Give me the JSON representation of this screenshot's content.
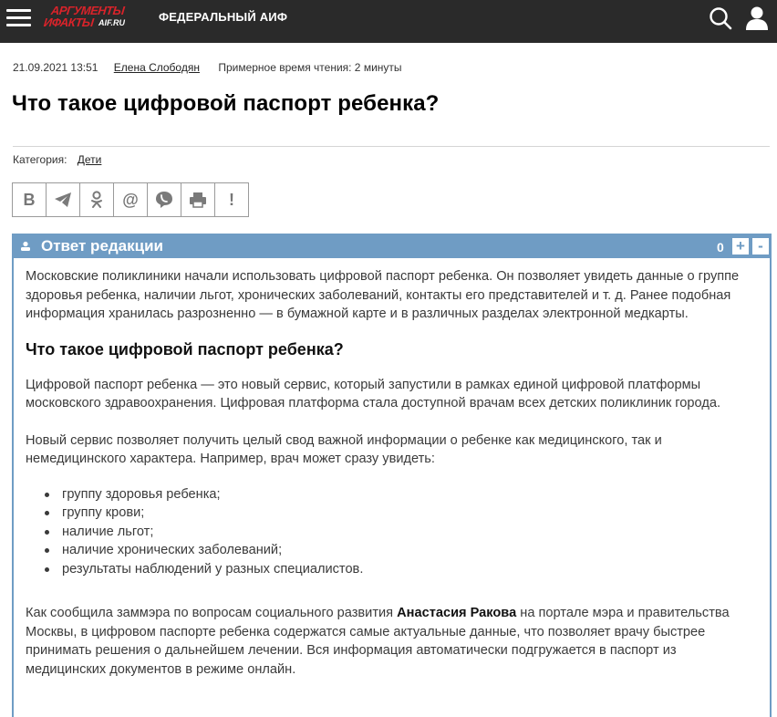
{
  "header": {
    "logo_line1": "АРГУМЕНТЫ",
    "logo_line2": "ИФАКТЫ",
    "logo_site": "AIF.RU",
    "nav_label": "ФЕДЕРАЛЬНЫЙ АИФ",
    "colors": {
      "bar": "#2a2a2a",
      "logo_red": "#d8232a"
    }
  },
  "meta": {
    "date": "21.09.2021 13:51",
    "author": "Елена Слободян",
    "reading_time": "Примерное время чтения: 2 минуты"
  },
  "article": {
    "title": "Что такое цифровой паспорт ребенка?",
    "category_label": "Категория:",
    "category_value": "Дети"
  },
  "share": {
    "buttons": [
      {
        "icon": "vk-icon",
        "glyph": "B"
      },
      {
        "icon": "telegram-icon",
        "glyph": "➤"
      },
      {
        "icon": "odnoklassniki-icon",
        "glyph": "ok"
      },
      {
        "icon": "mail-icon",
        "glyph": "@"
      },
      {
        "icon": "viber-icon",
        "glyph": "☏"
      },
      {
        "icon": "print-icon",
        "glyph": "⎙"
      },
      {
        "icon": "report-icon",
        "glyph": "!"
      }
    ]
  },
  "answer": {
    "title": "Ответ редакции",
    "count": "0",
    "plus": "+",
    "minus": "-",
    "color": "#6f9cc4",
    "intro": "Московские поликлиники начали использовать цифровой паспорт ребенка. Он позволяет увидеть данные о группе здоровья ребенка, наличии льгот, хронических заболеваний, контакты его представителей и т. д. Ранее подобная информация хранилась разрозненно — в бумажной карте и в различных разделах электронной медкарты.",
    "subheading": "Что такое цифровой паспорт ребенка?",
    "p1": "Цифровой паспорт ребенка — это новый сервис, который запустили в рамках единой цифровой платформы московского здравоохранения. Цифровая платформа стала доступной врачам всех детских поликлиник города.",
    "p2": "Новый сервис позволяет получить целый свод важной информации о ребенке как медицинского, так и немедицинского характера. Например, врач может сразу увидеть:",
    "list": [
      "группу здоровья ребенка;",
      "группу крови;",
      "наличие льгот;",
      "наличие хронических заболеваний;",
      "результаты наблюдений у разных специалистов."
    ],
    "p3_before": "Как сообщила заммэра по вопросам социального развития ",
    "p3_bold": "Анастасия Ракова",
    "p3_after": " на портале мэра и правительства Москвы, в цифровом паспорте ребенка содержатся самые актуальные данные, что позволяет врачу быстрее принимать решения о дальнейшем лечении. Вся информация автоматически подгружается в паспорт из медицинских документов в режиме онлайн."
  }
}
